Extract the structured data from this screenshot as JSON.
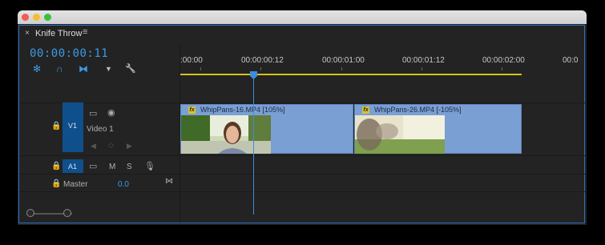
{
  "panel": {
    "tab_close": "×",
    "title": "Knife Throw",
    "menu": "≡",
    "timecode": "00:00:00:11"
  },
  "toolbar": {
    "tools": [
      {
        "name": "insert-sequence-icon",
        "glyph": "✻"
      },
      {
        "name": "snap-magnet-icon",
        "glyph": "∩"
      },
      {
        "name": "linked-selection-icon",
        "glyph": "⧓"
      },
      {
        "name": "add-marker-icon",
        "glyph": "▼"
      },
      {
        "name": "wrench-icon",
        "glyph": "🔧"
      }
    ]
  },
  "ruler": {
    "ticks": [
      ":00:00",
      "00:00:00:12",
      "00:00:01:00",
      "00:00:01:12",
      "00:00:02:00",
      "00:0"
    ]
  },
  "tracks": {
    "video": {
      "id": "V1",
      "name": "Video 1"
    },
    "audio": {
      "id": "A1",
      "toggles": [
        "M",
        "S"
      ]
    },
    "master": {
      "name": "Master",
      "value": "0.0"
    }
  },
  "clips": [
    {
      "name": "WhipPans-16.MP4 [105%]",
      "fx": "fx"
    },
    {
      "name": "WhipPans-26.MP4 [-105%]",
      "fx": "fx"
    }
  ],
  "colors": {
    "accent": "#3b9ae8",
    "clip": "#7a9fd3",
    "track_header": "#0f4f8c",
    "work_area": "#d4c417"
  }
}
